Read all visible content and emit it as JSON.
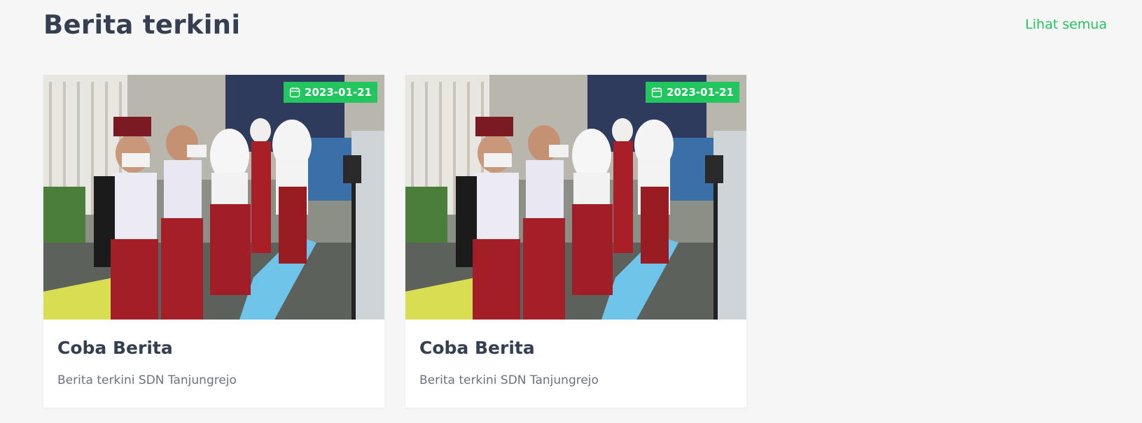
{
  "section": {
    "title": "Berita terkini",
    "see_all_label": "Lihat semua"
  },
  "accent_color": "#22c55e",
  "news": [
    {
      "date": "2023-01-21",
      "title": "Coba Berita",
      "description": "Berita terkini SDN Tanjungrejo",
      "image": "photo of uniformed schoolchildren wearing face masks"
    },
    {
      "date": "2023-01-21",
      "title": "Coba Berita",
      "description": "Berita terkini SDN Tanjungrejo",
      "image": "photo of uniformed schoolchildren wearing face masks"
    }
  ]
}
